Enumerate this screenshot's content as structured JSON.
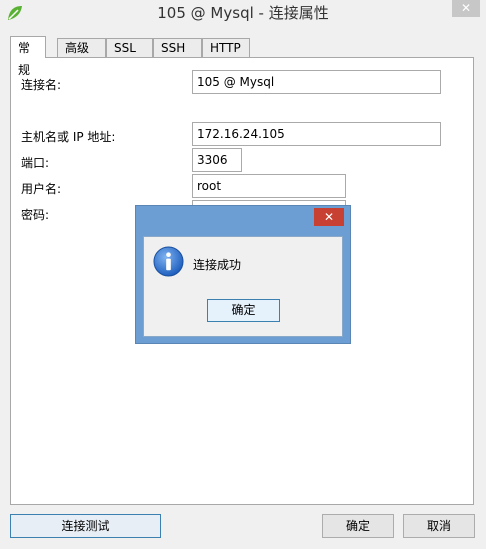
{
  "window": {
    "title": "105 @ Mysql - 连接属性",
    "close_glyph": "✕"
  },
  "tabs": [
    "常规",
    "高级",
    "SSL",
    "SSH",
    "HTTP"
  ],
  "form": {
    "conn_name_label": "连接名:",
    "conn_name_value": "105 @ Mysql",
    "host_label": "主机名或 IP 地址:",
    "host_value": "172.16.24.105",
    "port_label": "端口:",
    "port_value": "3306",
    "user_label": "用户名:",
    "user_value": "root",
    "password_label": "密码:"
  },
  "buttons": {
    "test": "连接测试",
    "ok": "确定",
    "cancel": "取消"
  },
  "dialog": {
    "message": "连接成功",
    "ok": "确定",
    "close_glyph": "✕"
  },
  "colors": {
    "dialog_frame": "#6c9ed3",
    "dialog_close": "#c84031",
    "info_icon": "#1f5fbf"
  }
}
